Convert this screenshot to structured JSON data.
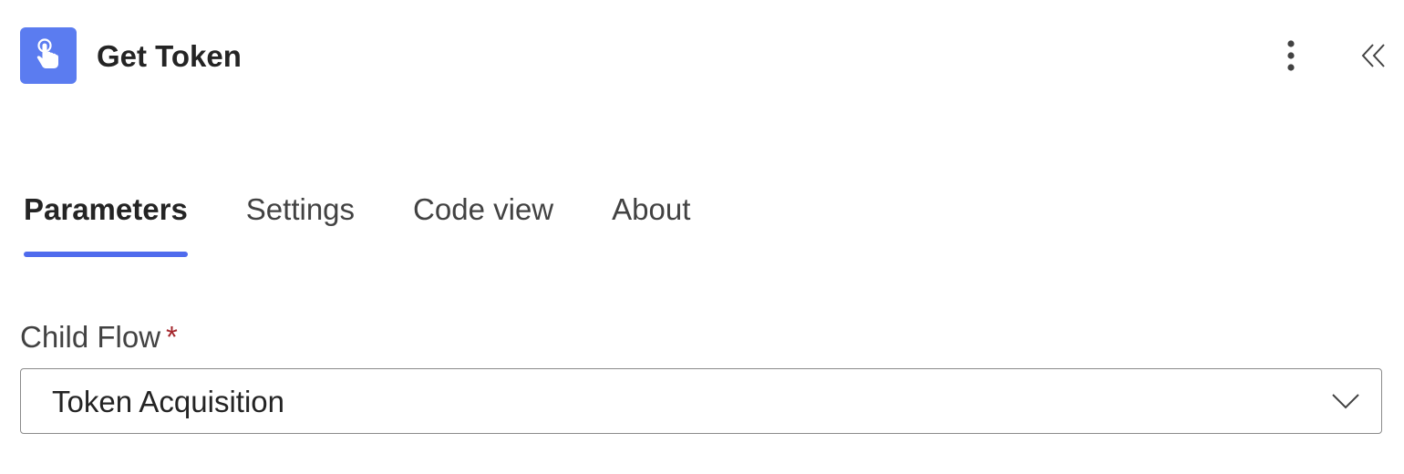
{
  "header": {
    "title": "Get Token",
    "icon": "hand-pointer-icon",
    "icon_bg_color": "#5b7cf0",
    "more_icon": "more-vertical-icon",
    "collapse_icon": "double-chevron-left-icon"
  },
  "tabs": [
    {
      "label": "Parameters",
      "active": true
    },
    {
      "label": "Settings",
      "active": false
    },
    {
      "label": "Code view",
      "active": false
    },
    {
      "label": "About",
      "active": false
    }
  ],
  "accent_color": "#4f6bed",
  "field": {
    "label": "Child Flow",
    "required_marker": "*",
    "value": "Token Acquisition",
    "dropdown_icon": "chevron-down-icon"
  }
}
